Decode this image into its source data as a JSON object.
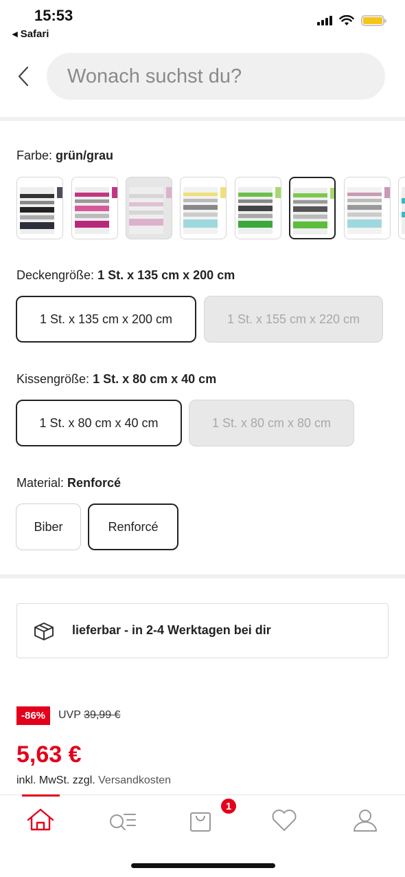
{
  "status_bar": {
    "time": "15:53",
    "back_app": "◂ Safari",
    "battery_color": "#f5c518"
  },
  "search": {
    "placeholder": "Wonach suchst du?"
  },
  "color_option": {
    "label": "Farbe:",
    "value": "grün/grau",
    "swatches": [
      {
        "name": "schwarz/grau",
        "accent": "#3a3f4a"
      },
      {
        "name": "pink/grau",
        "accent": "#c2367f"
      },
      {
        "name": "rosa/grau",
        "accent": "#d68fba",
        "disabled": true
      },
      {
        "name": "gelb/türkis",
        "accent": "#f0e07a"
      },
      {
        "name": "grün/grau",
        "accent": "#3aa83a"
      },
      {
        "name": "grün/grau selected",
        "accent": "#7cc94e",
        "selected": true
      },
      {
        "name": "rosé/türkis",
        "accent": "#c89ab5"
      }
    ]
  },
  "blanket_size": {
    "label": "Deckengröße:",
    "value": "1 St. x 135 cm x 200 cm",
    "options": [
      "1 St. x 135 cm x 200 cm",
      "1 St. x 155 cm x 220 cm"
    ]
  },
  "pillow_size": {
    "label": "Kissengröße:",
    "value": "1 St. x 80 cm x 40 cm",
    "options": [
      "1 St. x 80 cm x 40 cm",
      "1 St. x 80 cm x 80 cm"
    ]
  },
  "material": {
    "label": "Material:",
    "value": "Renforcé",
    "options": [
      "Biber",
      "Renforcé"
    ]
  },
  "delivery": {
    "text": "lieferbar - in 2-4 Werktagen bei dir"
  },
  "price": {
    "discount": "-86%",
    "uvp_label": "UVP",
    "uvp_value": "39,99 €",
    "current": "5,63 €",
    "tax_text": "inkl. MwSt. zzgl.",
    "shipping_link": "Versandkosten",
    "accent_color": "#e3001b"
  },
  "bottom_nav": {
    "items": [
      "home-icon",
      "search-list-icon",
      "cart-icon",
      "heart-icon",
      "user-icon"
    ],
    "cart_count": "1"
  }
}
